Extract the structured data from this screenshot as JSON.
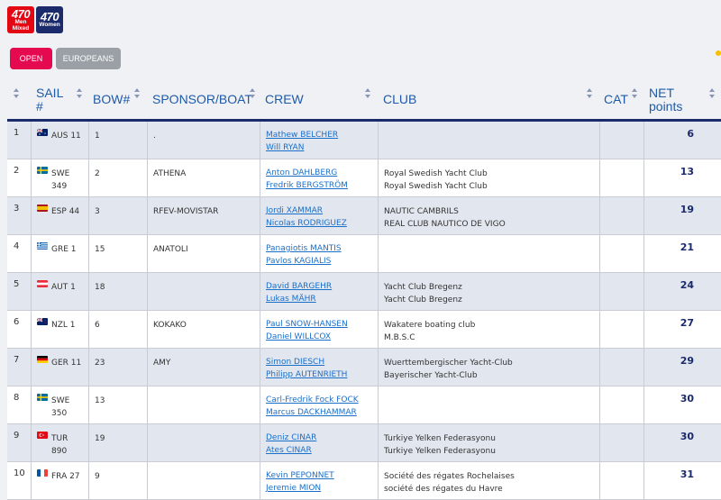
{
  "logos": {
    "men": {
      "big": "470",
      "small1": "Men",
      "small2": "Mixed"
    },
    "women": {
      "big": "470",
      "small1": "Women"
    }
  },
  "tabs": [
    {
      "label": "OPEN",
      "active": true
    },
    {
      "label": "EUROPEANS",
      "active": false
    }
  ],
  "columns": {
    "sail": "SAIL #",
    "bow": "BOW#",
    "sponsor": "SPONSOR/BOAT",
    "crew": "CREW",
    "club": "CLUB",
    "cat": "CAT",
    "net": "NET points"
  },
  "rows": [
    {
      "rank": "1",
      "flag": "AUS",
      "sail_line1": "AUS 11",
      "sail_line2": "",
      "bow": "1",
      "sponsor": ".",
      "crew1": "Mathew BELCHER",
      "crew2": "Will RYAN",
      "club1": "",
      "club2": "",
      "cat": "",
      "net": "6"
    },
    {
      "rank": "2",
      "flag": "SWE",
      "sail_line1": "SWE",
      "sail_line2": "349",
      "bow": "2",
      "sponsor": "ATHENA",
      "crew1": "Anton DAHLBERG",
      "crew2": "Fredrik BERGSTRÖM",
      "club1": "Royal Swedish Yacht Club",
      "club2": "Royal Swedish Yacht Club",
      "cat": "",
      "net": "13"
    },
    {
      "rank": "3",
      "flag": "ESP",
      "sail_line1": "ESP 44",
      "sail_line2": "",
      "bow": "3",
      "sponsor": "RFEV-MOVISTAR",
      "crew1": "Jordi XAMMAR",
      "crew2": "Nicolas RODRIGUEZ",
      "club1": "NAUTIC CAMBRILS",
      "club2": "REAL CLUB NAUTICO DE VIGO",
      "cat": "",
      "net": "19"
    },
    {
      "rank": "4",
      "flag": "GRE",
      "sail_line1": "GRE 1",
      "sail_line2": "",
      "bow": "15",
      "sponsor": "ANATOLI",
      "crew1": "Panagiotis MANTIS",
      "crew2": "Pavlos KAGIALIS",
      "club1": "",
      "club2": "",
      "cat": "",
      "net": "21"
    },
    {
      "rank": "5",
      "flag": "AUT",
      "sail_line1": "AUT 1",
      "sail_line2": "",
      "bow": "18",
      "sponsor": "",
      "crew1": "David BARGEHR",
      "crew2": "Lukas MÄHR",
      "club1": "Yacht Club Bregenz",
      "club2": "Yacht Club Bregenz",
      "cat": "",
      "net": "24"
    },
    {
      "rank": "6",
      "flag": "NZL",
      "sail_line1": "NZL 1",
      "sail_line2": "",
      "bow": "6",
      "sponsor": "KOKAKO",
      "crew1": "Paul SNOW-HANSEN",
      "crew2": "Daniel WILLCOX",
      "club1": "Wakatere boating club",
      "club2": "M.B.S.C",
      "cat": "",
      "net": "27"
    },
    {
      "rank": "7",
      "flag": "GER",
      "sail_line1": "GER 11",
      "sail_line2": "",
      "bow": "23",
      "sponsor": "AMY",
      "crew1": "Simon DIESCH",
      "crew2": "Philipp AUTENRIETH",
      "club1": "Wuerttembergischer Yacht-Club",
      "club2": "Bayerischer Yacht-Club",
      "cat": "",
      "net": "29"
    },
    {
      "rank": "8",
      "flag": "SWE",
      "sail_line1": "SWE",
      "sail_line2": "350",
      "bow": "13",
      "sponsor": "",
      "crew1": "Carl-Fredrik Fock FOCK",
      "crew2": "Marcus DACKHAMMAR ",
      "club1": "",
      "club2": "",
      "cat": "",
      "net": "30"
    },
    {
      "rank": "9",
      "flag": "TUR",
      "sail_line1": "TUR",
      "sail_line2": "890",
      "bow": "19",
      "sponsor": "",
      "crew1": "Deniz CINAR",
      "crew2": "Ates CINAR",
      "club1": "Turkiye Yelken Federasyonu",
      "club2": "Turkiye Yelken Federasyonu",
      "cat": "",
      "net": "30"
    },
    {
      "rank": "10",
      "flag": "FRA",
      "sail_line1": "FRA 27",
      "sail_line2": "",
      "bow": "9",
      "sponsor": "",
      "crew1": "Kevin PEPONNET",
      "crew2": "Jeremie MION",
      "club1": "Société des régates Rochelaises",
      "club2": "société des régates du Havre",
      "cat": "",
      "net": "31"
    }
  ]
}
